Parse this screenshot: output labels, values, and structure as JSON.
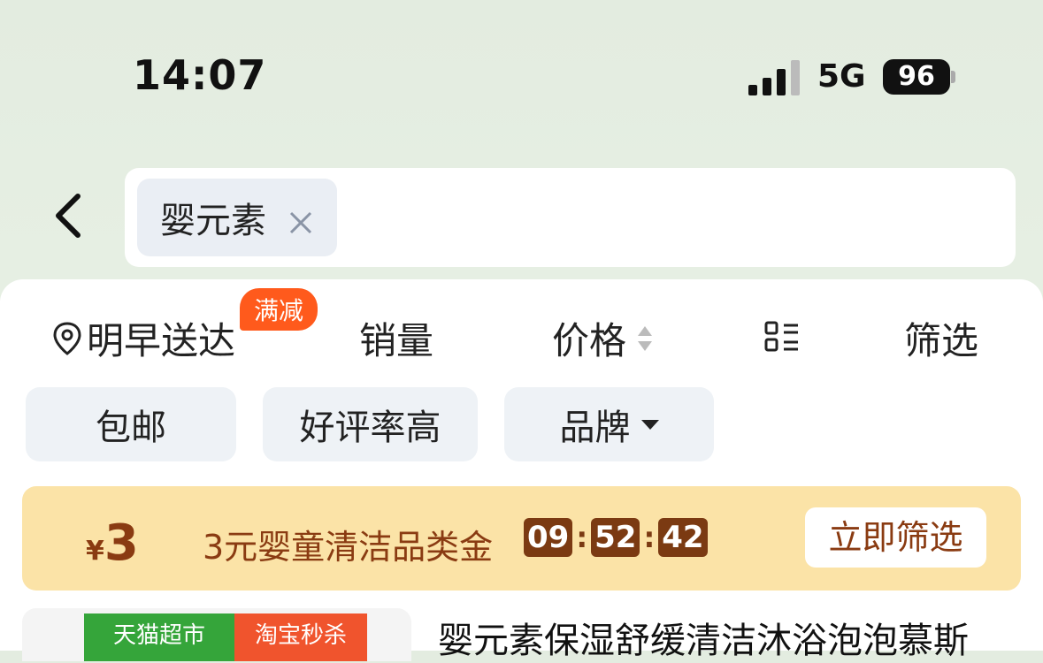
{
  "status_bar": {
    "time": "14:07",
    "network": "5G",
    "battery": "96"
  },
  "search": {
    "chip_text": "婴元素"
  },
  "sort_bar": {
    "delivery": "明早送达",
    "delivery_badge": "满减",
    "sales": "销量",
    "price": "价格",
    "filter": "筛选"
  },
  "filters": [
    "包邮",
    "好评率高",
    "品牌"
  ],
  "promo": {
    "currency": "¥",
    "amount": "3",
    "text": "3元婴童清洁品类金",
    "timer": [
      "09",
      "52",
      "42"
    ],
    "button": "立即筛选"
  },
  "product": {
    "tag1": "天猫超市",
    "tag2": "淘宝秒杀",
    "title": "婴元素保湿舒缓清洁沐浴泡泡慕斯"
  },
  "colors": {
    "accent": "#ff5a1c",
    "promo_bg": "#fbe3a7",
    "promo_text": "#8a3b12"
  }
}
